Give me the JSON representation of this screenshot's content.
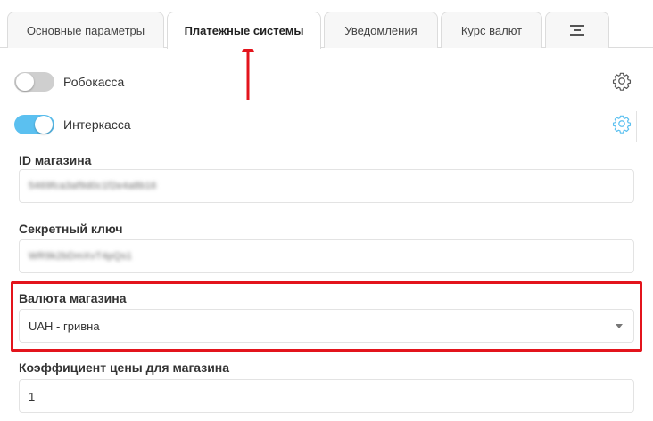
{
  "tabs": [
    {
      "label": "Основные параметры"
    },
    {
      "label": "Платежные системы"
    },
    {
      "label": "Уведомления"
    },
    {
      "label": "Курс валют"
    },
    {
      "icon": "align-lines-icon"
    }
  ],
  "payment_systems": [
    {
      "label": "Робокасса",
      "enabled": false
    },
    {
      "label": "Интеркасса",
      "enabled": true
    }
  ],
  "fields": {
    "shop_id": {
      "label": "ID магазина",
      "value": "5469fca3af9d0c1f2e4a8b16"
    },
    "secret_key": {
      "label": "Секретный ключ",
      "value": "WR9k2bDmXvT4pQs1"
    },
    "currency": {
      "label": "Валюта магазина",
      "value": "UAH - гривна"
    },
    "price_coef": {
      "label": "Коэффициент цены для магазина",
      "value": "1"
    }
  },
  "colors": {
    "accent": "#5bc0f0",
    "highlight": "#e3141c",
    "toggle_off": "#cfcfcf"
  }
}
